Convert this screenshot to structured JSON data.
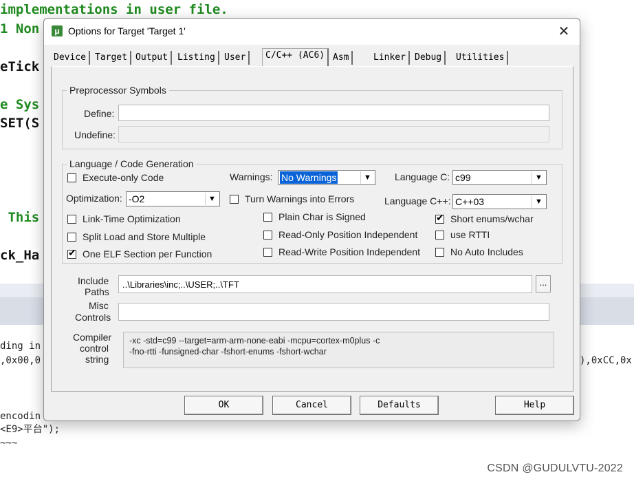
{
  "background": {
    "code_lines": [
      {
        "text": "implementations in user file.",
        "style": "green"
      },
      {
        "text": "1 Non",
        "style": "green"
      },
      {
        "text": "eTick",
        "style": "black"
      },
      {
        "text": "e Sys",
        "style": "green"
      },
      {
        "text": "SET(S",
        "style": "black"
      },
      {
        "text": " This",
        "style": "green"
      },
      {
        "text": "ck_Ha",
        "style": "black"
      }
    ],
    "output_lines": [
      "ding in",
      ",0x00,0",
      "),0xCC,0x",
      "encodin",
      "<E9>平台\");",
      "~~~"
    ],
    "watermark": "CSDN @GUDULVTU-2022"
  },
  "dialog": {
    "title": "Options for Target 'Target 1'",
    "app_icon": "μ",
    "close_icon": "✕",
    "tabs": [
      "Device",
      "Target",
      "Output",
      "Listing",
      "User",
      "C/C++ (AC6)",
      "Asm",
      "Linker",
      "Debug",
      "Utilities"
    ],
    "active_tab": "C/C++ (AC6)",
    "preprocessor": {
      "legend": "Preprocessor Symbols",
      "define_label": "Define:",
      "define_value": "",
      "undefine_label": "Undefine:",
      "undefine_value": ""
    },
    "language": {
      "legend": "Language / Code Generation",
      "execute_only": {
        "label": "Execute-only Code",
        "checked": false
      },
      "warnings_label": "Warnings:",
      "warnings_value": "No Warnings",
      "language_c_label": "Language C:",
      "language_c_value": "c99",
      "optimization_label": "Optimization:",
      "optimization_value": "-O2",
      "turn_warnings_errors": {
        "label": "Turn Warnings into Errors",
        "checked": false
      },
      "language_cpp_label": "Language C++:",
      "language_cpp_value": "C++03",
      "link_time": {
        "label": "Link-Time Optimization",
        "checked": false
      },
      "plain_char": {
        "label": "Plain Char is Signed",
        "checked": false
      },
      "short_enums": {
        "label": "Short enums/wchar",
        "checked": true
      },
      "split_load": {
        "label": "Split Load and Store Multiple",
        "checked": false
      },
      "ropi": {
        "label": "Read-Only Position Independent",
        "checked": false
      },
      "rtti": {
        "label": "use RTTI",
        "checked": false
      },
      "one_elf": {
        "label": "One ELF Section per Function",
        "checked": true
      },
      "rwpi": {
        "label": "Read-Write Position Independent",
        "checked": false
      },
      "no_auto_includes": {
        "label": "No Auto Includes",
        "checked": false
      }
    },
    "include_label_1": "Include",
    "include_label_2": "Paths",
    "include_value": "..\\Libraries\\inc;..\\USER;..\\TFT",
    "browse_label": "...",
    "misc_label_1": "Misc",
    "misc_label_2": "Controls",
    "misc_value": "",
    "compiler_label_1": "Compiler",
    "compiler_label_2": "control",
    "compiler_label_3": "string",
    "compiler_string": "-xc -std=c99 --target=arm-arm-none-eabi -mcpu=cortex-m0plus -c\n-fno-rtti -funsigned-char -fshort-enums -fshort-wchar",
    "buttons": {
      "ok": "OK",
      "cancel": "Cancel",
      "defaults": "Defaults",
      "help": "Help"
    },
    "check_glyph": "✔",
    "arrow_glyph": "▼"
  }
}
